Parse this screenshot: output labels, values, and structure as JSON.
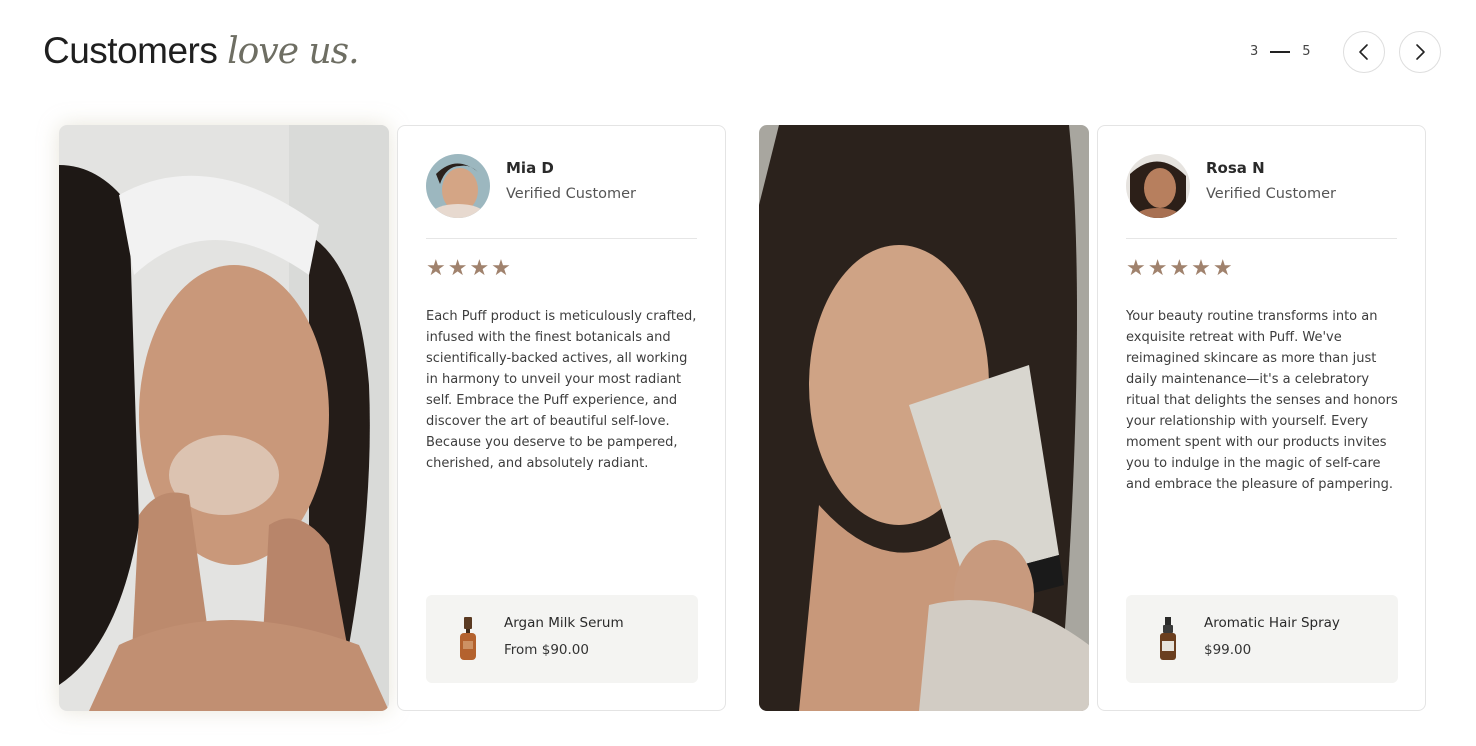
{
  "heading": {
    "prefix": "Customers",
    "accent": "love us."
  },
  "pager": {
    "current": "3",
    "total": "5"
  },
  "nav": {
    "prev_icon": "chevron-left-icon",
    "next_icon": "chevron-right-icon"
  },
  "colors": {
    "star": "#a0826d",
    "product_bg": "#f4f4f2",
    "border": "#e4e4e4"
  },
  "reviews": [
    {
      "name": "Mia D",
      "role": "Verified Customer",
      "stars": "★★★★",
      "rating": 4,
      "text": "Each Puff product is meticulously crafted, infused with the finest botanicals and scientifically-backed actives, all working in harmony to unveil your most radiant self. Embrace the Puff experience, and discover the art of beautiful self-love. Because you deserve to be pampered, cherished, and absolutely radiant.",
      "product": {
        "name": "Argan Milk Serum",
        "price": "From $90.00"
      }
    },
    {
      "name": "Rosa N",
      "role": "Verified Customer",
      "stars": "★★★★★",
      "rating": 5,
      "text": "Your beauty routine transforms into an exquisite retreat with Puff. We've reimagined skincare as more than just daily maintenance—it's a celebratory ritual that delights the senses and honors your relationship with yourself. Every moment spent with our products invites you to indulge in the magic of self-care and embrace the pleasure of pampering.",
      "product": {
        "name": "Aromatic Hair Spray",
        "price": "$99.00"
      }
    }
  ]
}
